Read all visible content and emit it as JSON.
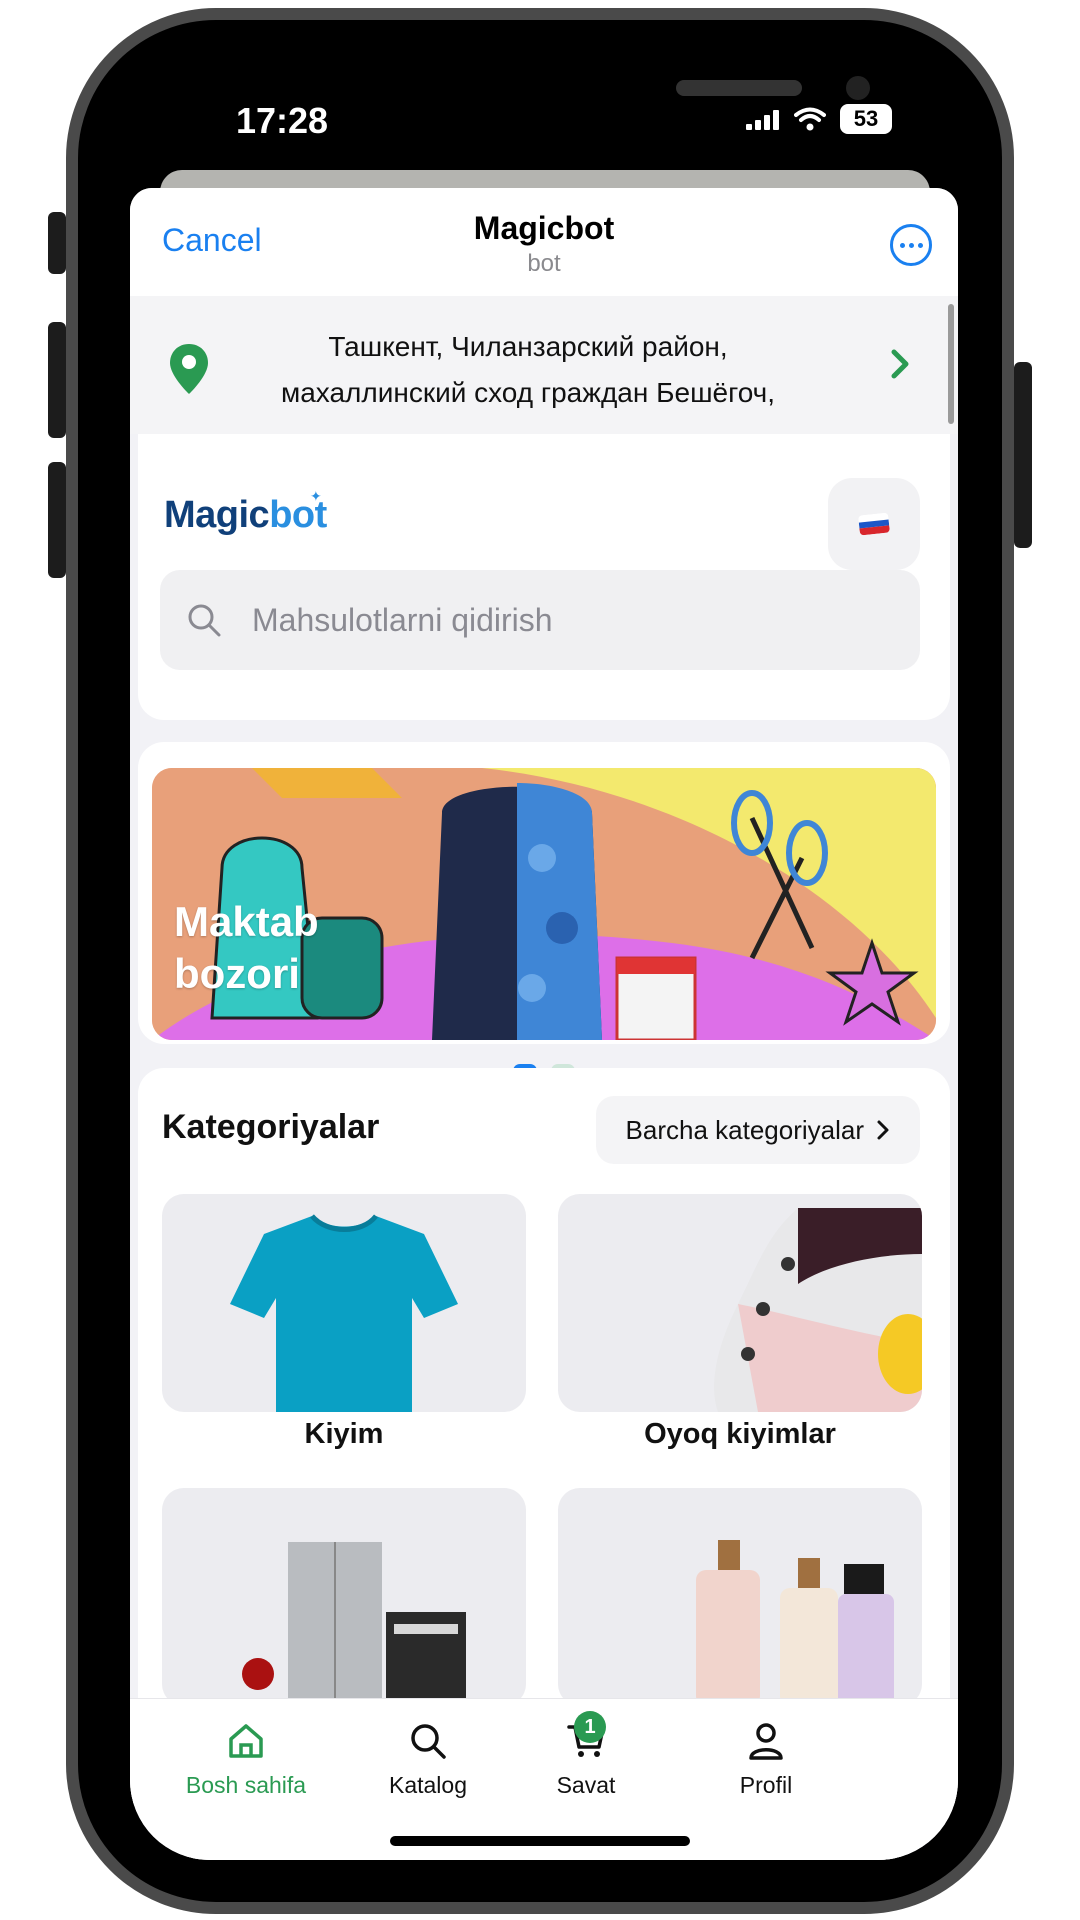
{
  "status_bar": {
    "time": "17:28",
    "battery": "53"
  },
  "sheet_header": {
    "cancel_label": "Cancel",
    "title": "Magicbot",
    "subtitle": "bot"
  },
  "address": {
    "line1": "Ташкент, Чиланзарский район,",
    "line2": "махаллинский сход граждан Бешёгоч,"
  },
  "brand": {
    "logo_part1": "Magic",
    "logo_part2": "bot"
  },
  "search": {
    "placeholder": "Mahsulotlarni qidirish"
  },
  "banner": {
    "line1": "Maktab",
    "line2": "bozori",
    "slides": 2,
    "active_slide": 1
  },
  "categories": {
    "title": "Kategoriyalar",
    "all_label": "Barcha kategoriyalar",
    "items": [
      {
        "label": "Kiyim"
      },
      {
        "label": "Oyoq kiyimlar"
      },
      {
        "label": ""
      },
      {
        "label": ""
      }
    ]
  },
  "tabbar": {
    "items": [
      {
        "label": "Bosh sahifa",
        "icon": "home-icon",
        "active": true
      },
      {
        "label": "Katalog",
        "icon": "search-icon"
      },
      {
        "label": "Savat",
        "icon": "cart-icon",
        "badge": "1"
      },
      {
        "label": "Profil",
        "icon": "user-icon"
      }
    ]
  },
  "colors": {
    "accent": "#2a9a52",
    "telegram_blue": "#1a80f0",
    "logo_dark": "#10407a",
    "logo_light": "#2a8fe0"
  }
}
